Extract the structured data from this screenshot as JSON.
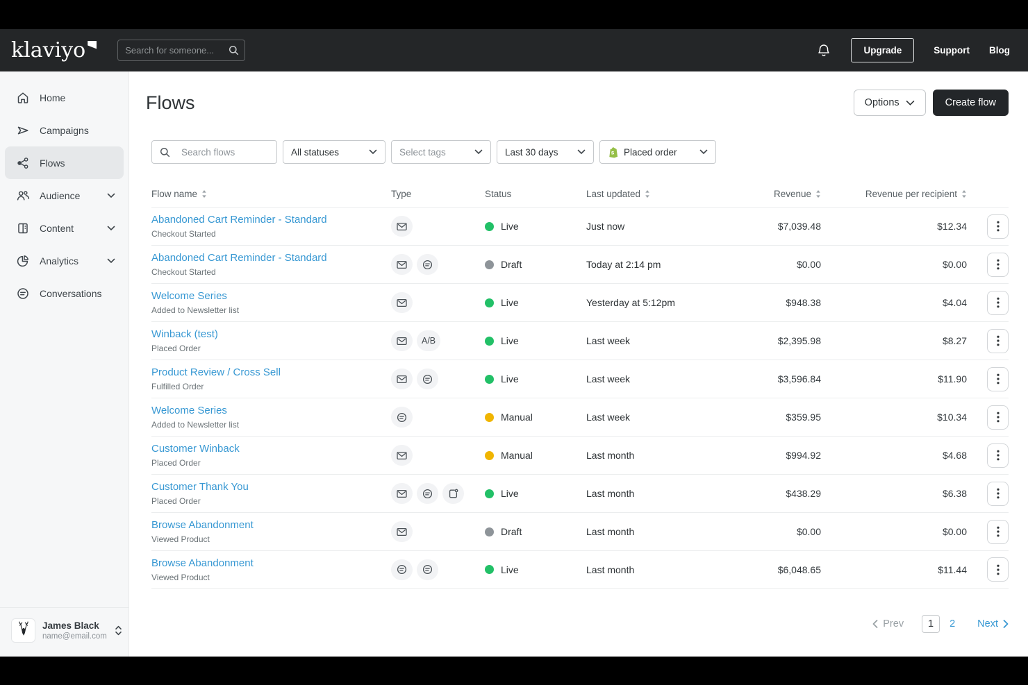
{
  "topnav": {
    "logo": "klaviyo",
    "search_placeholder": "Search for someone...",
    "upgrade_label": "Upgrade",
    "support_label": "Support",
    "blog_label": "Blog"
  },
  "sidebar": {
    "items": [
      {
        "label": "Home",
        "icon": "home-icon",
        "active": false,
        "expandable": false
      },
      {
        "label": "Campaigns",
        "icon": "campaigns-icon",
        "active": false,
        "expandable": false
      },
      {
        "label": "Flows",
        "icon": "flows-icon",
        "active": true,
        "expandable": false
      },
      {
        "label": "Audience",
        "icon": "audience-icon",
        "active": false,
        "expandable": true
      },
      {
        "label": "Content",
        "icon": "content-icon",
        "active": false,
        "expandable": true
      },
      {
        "label": "Analytics",
        "icon": "analytics-icon",
        "active": false,
        "expandable": true
      },
      {
        "label": "Conversations",
        "icon": "conversations-icon",
        "active": false,
        "expandable": false
      }
    ],
    "user": {
      "name": "James Black",
      "email": "name@email.com",
      "avatar_icon": "deer-icon"
    }
  },
  "header": {
    "title": "Flows",
    "options_label": "Options",
    "create_label": "Create flow"
  },
  "filters": {
    "search_placeholder": "Search flows",
    "status_value": "All statuses",
    "tags_value": "Select tags",
    "date_value": "Last 30 days",
    "metric_value": "Placed order",
    "metric_icon": "shopify-bag-icon"
  },
  "table": {
    "ab_label": "A/B",
    "columns": [
      {
        "label": "Flow name",
        "sortable": true
      },
      {
        "label": "Type",
        "sortable": false
      },
      {
        "label": "Status",
        "sortable": false
      },
      {
        "label": "Last updated",
        "sortable": true
      },
      {
        "label": "Revenue",
        "sortable": true
      },
      {
        "label": "Revenue per recipient",
        "sortable": true
      }
    ],
    "rows": [
      {
        "name": "Abandoned Cart Reminder - Standard",
        "trigger": "Checkout Started",
        "types": [
          "email"
        ],
        "status": "Live",
        "last_updated": "Just now",
        "revenue": "$7,039.48",
        "revenue_per_recipient": "$12.34"
      },
      {
        "name": "Abandoned Cart Reminder - Standard",
        "trigger": "Checkout Started",
        "types": [
          "email",
          "sms"
        ],
        "status": "Draft",
        "last_updated": "Today at 2:14 pm",
        "revenue": "$0.00",
        "revenue_per_recipient": "$0.00"
      },
      {
        "name": "Welcome Series",
        "trigger": "Added to Newsletter list",
        "types": [
          "email"
        ],
        "status": "Live",
        "last_updated": "Yesterday at 5:12pm",
        "revenue": "$948.38",
        "revenue_per_recipient": "$4.04"
      },
      {
        "name": "Winback (test)",
        "trigger": "Placed Order",
        "types": [
          "email",
          "ab"
        ],
        "status": "Live",
        "last_updated": "Last week",
        "revenue": "$2,395.98",
        "revenue_per_recipient": "$8.27"
      },
      {
        "name": "Product Review / Cross Sell",
        "trigger": "Fulfilled Order",
        "types": [
          "email",
          "sms"
        ],
        "status": "Live",
        "last_updated": "Last week",
        "revenue": "$3,596.84",
        "revenue_per_recipient": "$11.90"
      },
      {
        "name": "Welcome Series",
        "trigger": "Added to Newsletter list",
        "types": [
          "sms"
        ],
        "status": "Manual",
        "last_updated": "Last week",
        "revenue": "$359.95",
        "revenue_per_recipient": "$10.34"
      },
      {
        "name": "Customer Winback",
        "trigger": "Placed Order",
        "types": [
          "email"
        ],
        "status": "Manual",
        "last_updated": "Last month",
        "revenue": "$994.92",
        "revenue_per_recipient": "$4.68"
      },
      {
        "name": "Customer Thank You",
        "trigger": "Placed Order",
        "types": [
          "email",
          "sms",
          "notification"
        ],
        "status": "Live",
        "last_updated": "Last month",
        "revenue": "$438.29",
        "revenue_per_recipient": "$6.38"
      },
      {
        "name": "Browse Abandonment",
        "trigger": "Viewed Product",
        "types": [
          "email"
        ],
        "status": "Draft",
        "last_updated": "Last month",
        "revenue": "$0.00",
        "revenue_per_recipient": "$0.00"
      },
      {
        "name": "Browse Abandonment",
        "trigger": "Viewed Product",
        "types": [
          "sms",
          "sms"
        ],
        "status": "Live",
        "last_updated": "Last month",
        "revenue": "$6,048.65",
        "revenue_per_recipient": "$11.44"
      }
    ]
  },
  "pagination": {
    "prev_label": "Prev",
    "current_page": "1",
    "other_page": "2",
    "next_label": "Next"
  },
  "colors": {
    "status_live": "#22c067",
    "status_manual": "#f0b501",
    "status_draft": "#8e9499",
    "link_blue": "#3798d3",
    "accent_dark": "#232629",
    "shopify_green": "#95bf47"
  }
}
